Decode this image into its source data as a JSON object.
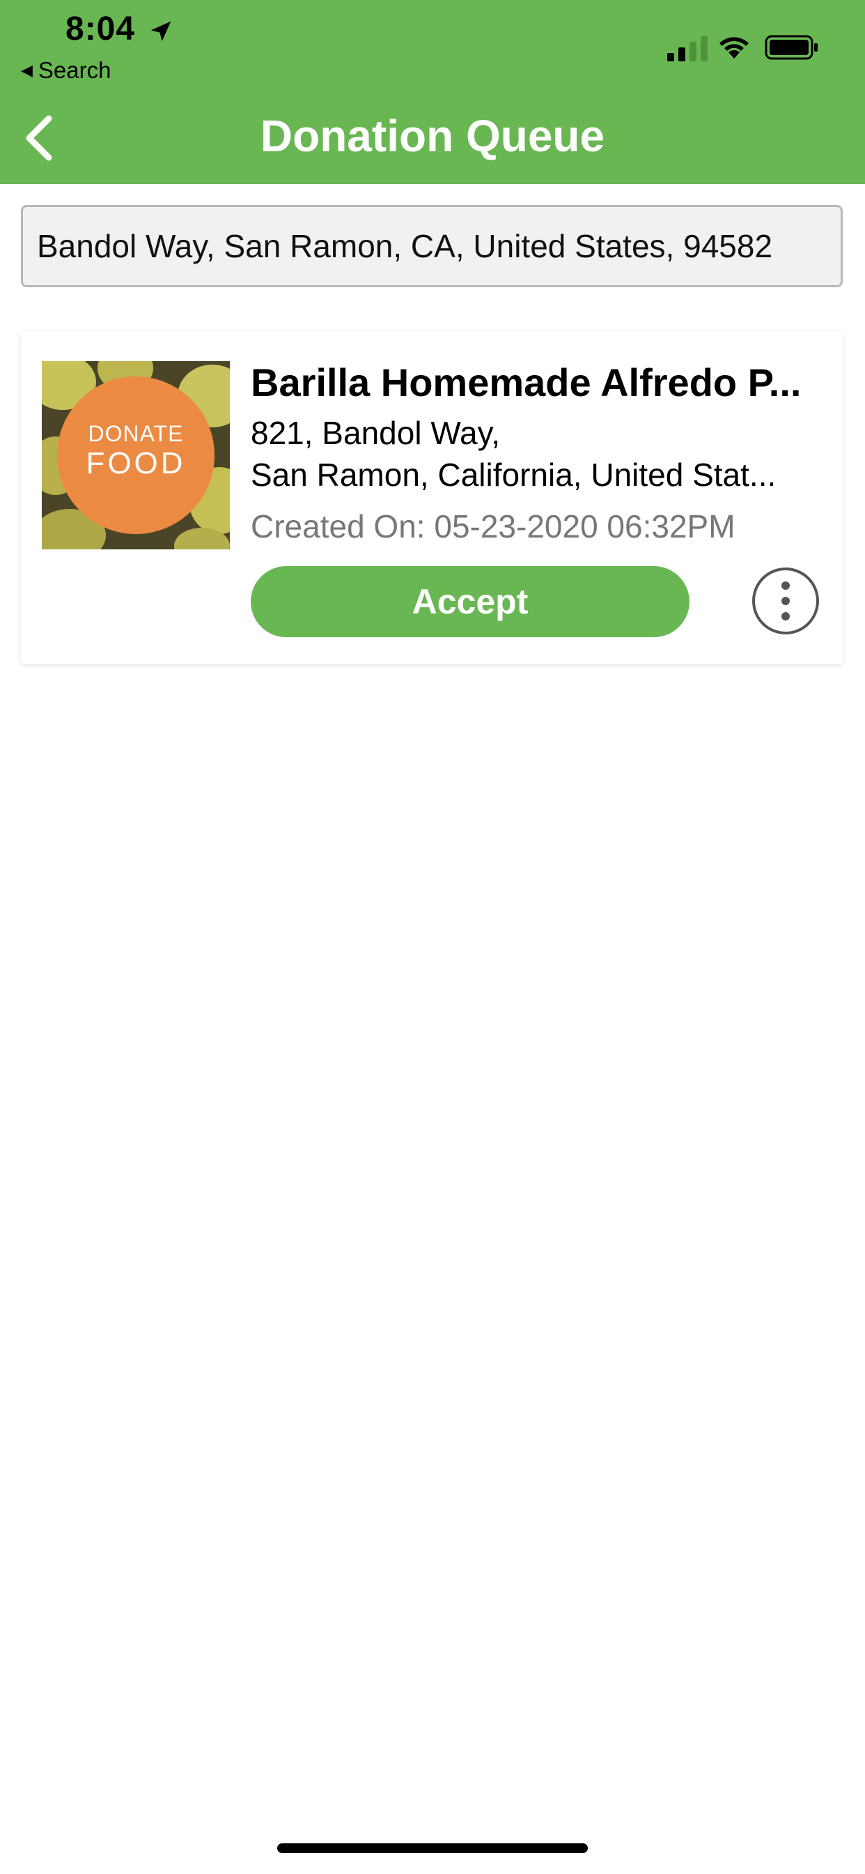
{
  "status_bar": {
    "time": "8:04",
    "back_app_label": "Search",
    "icons": [
      "location-arrow-icon",
      "cellular-signal-icon",
      "wifi-icon",
      "battery-icon"
    ]
  },
  "header": {
    "title": "Donation Queue",
    "back_icon": "chevron-left-icon",
    "background_color": "#69b752"
  },
  "search": {
    "value": "Bandol Way, San Ramon, CA, United States, 94582"
  },
  "donations": [
    {
      "image_text_line1": "DONATE",
      "image_text_line2": "FOOD",
      "title": "Barilla Homemade Alfredo P...",
      "address_line1": "821, Bandol Way,",
      "address_line2": "San Ramon, California, United Stat...",
      "created": "Created On: 05-23-2020 06:32PM",
      "accept_label": "Accept",
      "more_icon": "more-vertical-icon"
    }
  ],
  "colors": {
    "accent": "#69b752",
    "created_text": "#777777"
  }
}
